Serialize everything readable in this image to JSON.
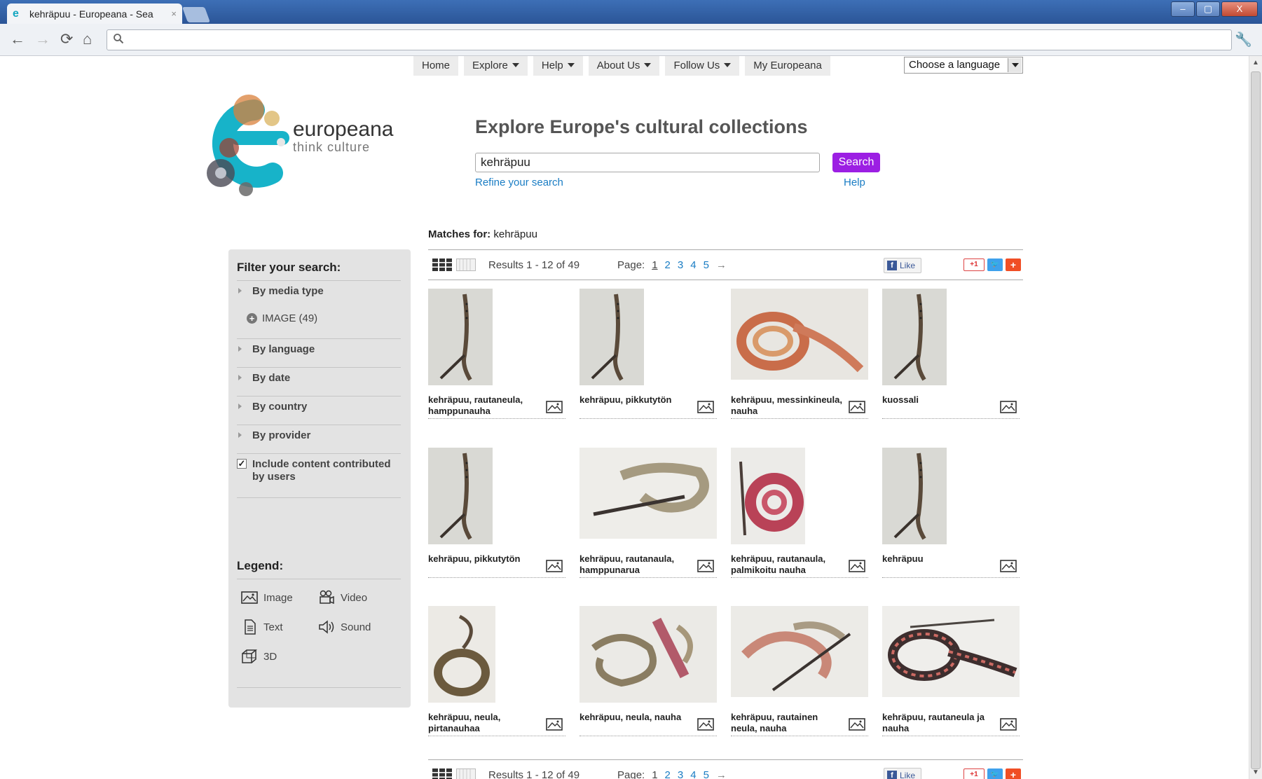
{
  "browser": {
    "tab_title": "kehräpuu - Europeana - Sea",
    "tab_close": "×",
    "window_controls": [
      "–",
      "▢",
      "X"
    ]
  },
  "topnav": {
    "items": [
      {
        "label": "Home",
        "dropdown": false
      },
      {
        "label": "Explore",
        "dropdown": true
      },
      {
        "label": "Help",
        "dropdown": true
      },
      {
        "label": "About Us",
        "dropdown": true
      },
      {
        "label": "Follow Us",
        "dropdown": true
      },
      {
        "label": "My Europeana",
        "dropdown": false
      }
    ],
    "language_select": "Choose a language"
  },
  "brand": {
    "name": "europeana",
    "tagline": "think culture"
  },
  "search": {
    "headline": "Explore Europe's cultural collections",
    "query": "kehräpuu",
    "button": "Search",
    "refine": "Refine your search",
    "help": "Help"
  },
  "matches": {
    "label": "Matches for:",
    "query": "kehräpuu"
  },
  "sidebar": {
    "filter_title": "Filter your search:",
    "media_type": "By media type",
    "facet_image": "IMAGE (49)",
    "language": "By language",
    "date": "By date",
    "country": "By country",
    "provider": "By provider",
    "user_content": "Include content contributed by users",
    "legend_title": "Legend:",
    "legend": {
      "image": "Image",
      "video": "Video",
      "text": "Text",
      "sound": "Sound",
      "threed": "3D"
    }
  },
  "results": {
    "summary": "Results 1 - 12 of 49",
    "page_label": "Page:",
    "pages": [
      "1",
      "2",
      "3",
      "4",
      "5"
    ],
    "next": "→",
    "like": "Like",
    "gplus": "+1",
    "items": [
      {
        "title": "kehräpuu, rautaneula, hamppunauha",
        "thumb": "stick"
      },
      {
        "title": "kehräpuu, pikkutytön",
        "thumb": "stick"
      },
      {
        "title": "kehräpuu, messinkineula, nauha",
        "thumb": "coil-band"
      },
      {
        "title": "kuossali",
        "thumb": "stick"
      },
      {
        "title": "kehräpuu, pikkutytön",
        "thumb": "stick"
      },
      {
        "title": "kehräpuu, rautanaula, hamppunarua",
        "thumb": "rope"
      },
      {
        "title": "kehräpuu, rautanaula, palmikoitu nauha",
        "thumb": "red-coil"
      },
      {
        "title": "kehräpuu",
        "thumb": "stick"
      },
      {
        "title": "kehräpuu, neula, pirtanauhaa",
        "thumb": "dark-coil"
      },
      {
        "title": "kehräpuu, neula, nauha",
        "thumb": "tangle"
      },
      {
        "title": "kehräpuu, rautainen neula, nauha",
        "thumb": "needle-tangle"
      },
      {
        "title": "kehräpuu, rautaneula ja nauha",
        "thumb": "patterned-band"
      }
    ]
  },
  "colors": {
    "accent": "#9c1fe3",
    "link": "#1a7dc4",
    "sidebar_bg": "#e3e3e3"
  }
}
